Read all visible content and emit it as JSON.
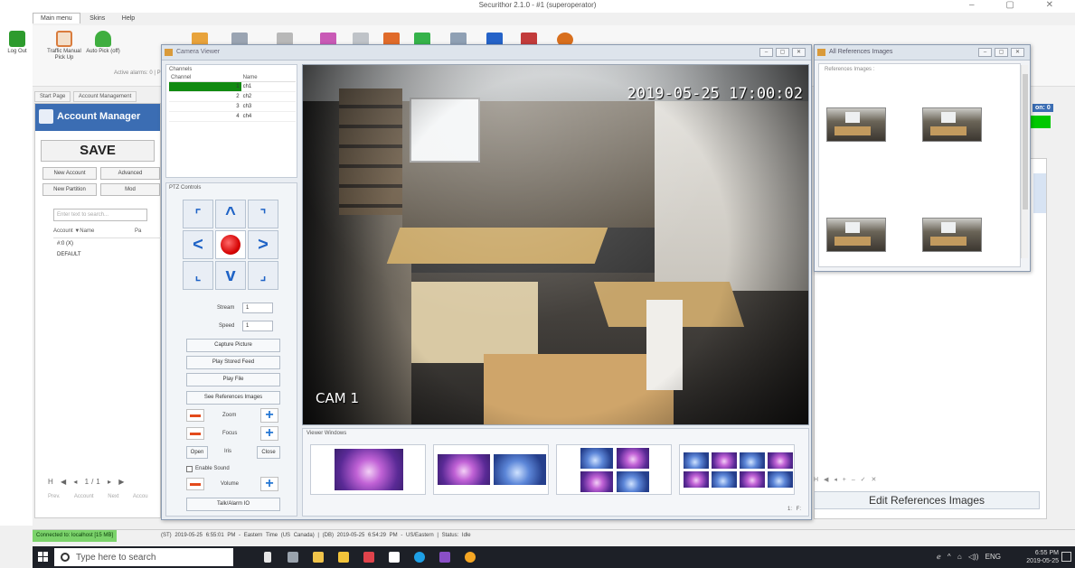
{
  "app": {
    "title": "Securithor 2.1.0 - #1 (superoperator)",
    "window_buttons": "–  ▢  ✕"
  },
  "menu_tabs": [
    "Main menu",
    "Skins",
    "Help"
  ],
  "ribbon": {
    "buttons": [
      {
        "label": "Log Out",
        "color": "#2d9b2d"
      },
      {
        "label": "Traffic Manual Pick Up",
        "color": "#d97c3d"
      },
      {
        "label": "Auto Pick (off)",
        "color": "#3fae3f"
      }
    ],
    "sub_label": "Active alarms: 0 | Pro"
  },
  "doc_tabs": [
    "Start Page",
    "Account Management"
  ],
  "account": {
    "title": "Account Manager",
    "save_label": "SAVE",
    "new_account": "New Account",
    "advanced": "Advanced",
    "new_partition": "New Partition",
    "modify": "Mod",
    "search_placeholder": "Enter text to search...",
    "col_account": "Account ▼Name",
    "col_pa": "Pa",
    "row_group": "#:0 (X)",
    "row_default": "DEFAULT",
    "pager": "H ◀ ◂ 1/1 ▸ ▶",
    "prev_account": "Prev. Account",
    "next_account": "Next Accou"
  },
  "camera_viewer": {
    "title": "Camera Viewer",
    "channels_header": "Channels",
    "col_channel": "Channel",
    "col_name": "Name",
    "channels": [
      {
        "num": "1",
        "name": "ch1"
      },
      {
        "num": "2",
        "name": "ch2"
      },
      {
        "num": "3",
        "name": "ch3"
      },
      {
        "num": "4",
        "name": "ch4"
      }
    ],
    "ptz_header": "PTZ Controls",
    "stream_label": "Stream",
    "stream_value": "1",
    "speed_label": "Speed",
    "speed_value": "1",
    "capture_picture": "Capture Picture",
    "play_stored_feed": "Play Stored Feed",
    "play_file": "Play File",
    "see_reference_images": "See References Images",
    "zoom_label": "Zoom",
    "focus_label": "Focus",
    "open_label": "Open",
    "iris_label": "Iris",
    "close_label": "Close",
    "enable_sound": "Enable Sound",
    "volume_label": "Volume",
    "talk_alarm": "Talk/Alarm IO",
    "timestamp": "2019-05-25 17:00:02",
    "cam_label": "CAM 1",
    "viewer_windows": "Viewer Windows",
    "viewer_footer": "1: F:"
  },
  "references": {
    "title": "All References Images",
    "label": "References Images :",
    "edit_button": "Edit References Images"
  },
  "right_panel": {
    "on_label": "on: 0",
    "toolbar": "H ◀ ◂ + – ✓ ✕"
  },
  "status_bar": {
    "connected": "Connected to: localhost [15 MB]",
    "text": "(ST) 2019-05-25 6:55:01 PM - Eastern Time (US Canada)  |  (DB) 2019-05-25 6:54:29 PM - US/Eastern  |  Status: Idle"
  },
  "taskbar": {
    "search_placeholder": "Type here to search",
    "tray_icons": "ℯ ^ ⌂ ◁)) ENG",
    "time": "6:55 PM",
    "date": "2019-05-25"
  }
}
